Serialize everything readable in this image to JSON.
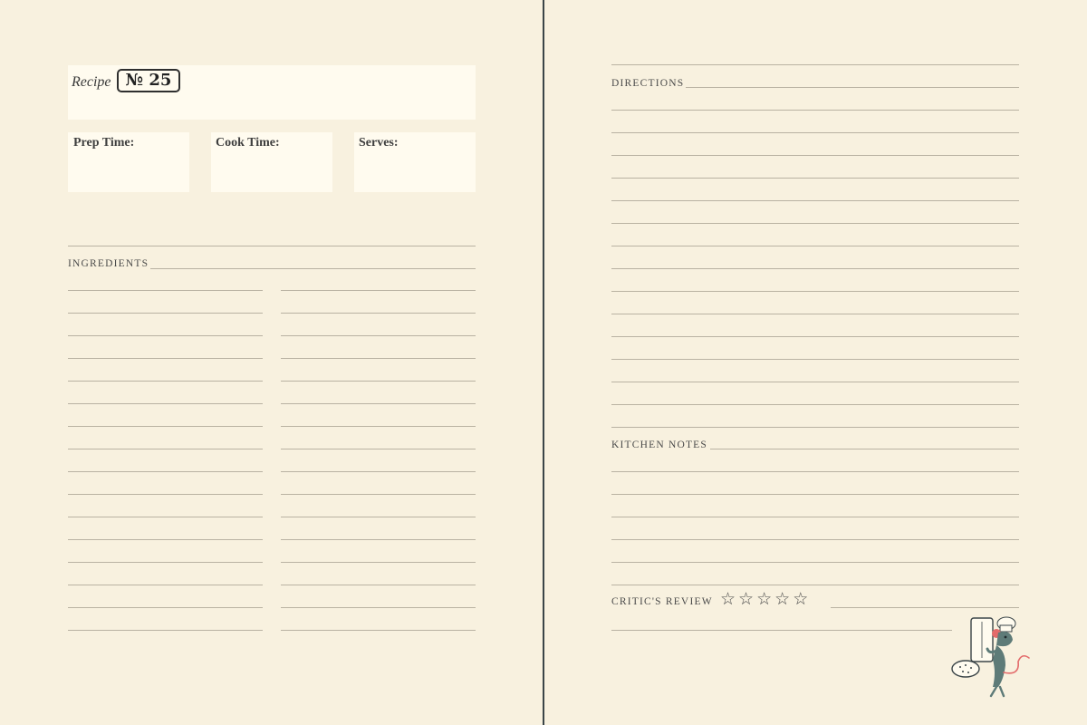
{
  "left_page": {
    "recipe_label": "Recipe",
    "recipe_number": "№ 25",
    "prep_time_label": "Prep Time:",
    "cook_time_label": "Cook Time:",
    "serves_label": "Serves:",
    "ingredients_label": "INGREDIENTS"
  },
  "right_page": {
    "directions_label": "DIRECTIONS",
    "kitchen_notes_label": "KITCHEN NOTES",
    "critics_review_label": "CRITIC'S REVIEW",
    "rating": {
      "max": 5,
      "filled": 0
    }
  },
  "illustration": {
    "icon": "chef-rat-with-salt-shaker-icon"
  },
  "colors": {
    "paper": "#f8f1df",
    "box": "#fffbef",
    "rule": "#b9b2a2",
    "spine": "#3b4548",
    "rat": "#5e7b78",
    "accent": "#e36b6b"
  }
}
